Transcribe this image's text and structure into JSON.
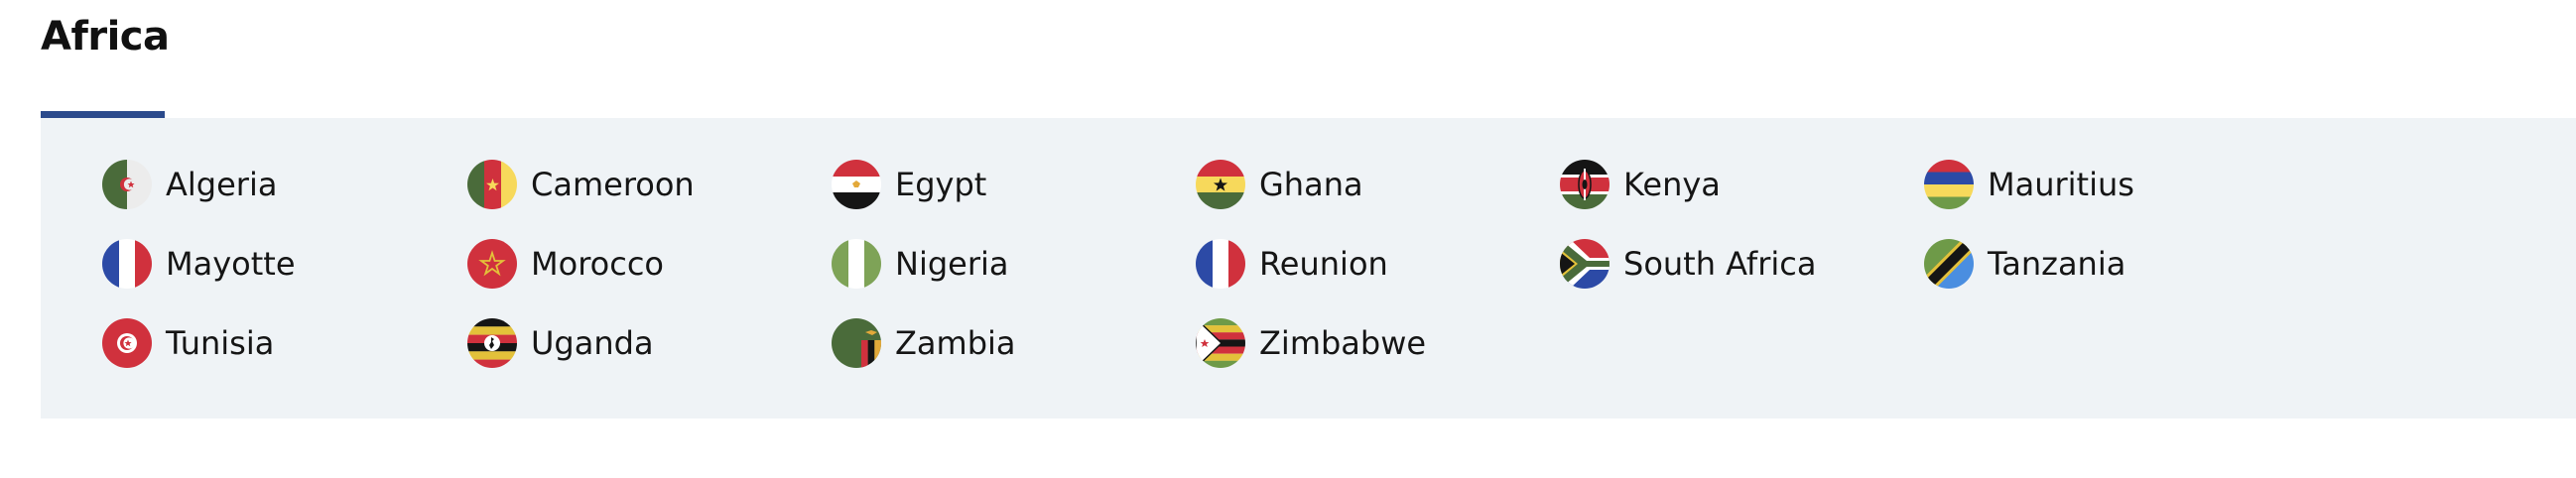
{
  "region": {
    "title": "Africa"
  },
  "countries": [
    {
      "name": "Algeria",
      "flag": "algeria-flag-icon"
    },
    {
      "name": "Cameroon",
      "flag": "cameroon-flag-icon"
    },
    {
      "name": "Egypt",
      "flag": "egypt-flag-icon"
    },
    {
      "name": "Ghana",
      "flag": "ghana-flag-icon"
    },
    {
      "name": "Kenya",
      "flag": "kenya-flag-icon"
    },
    {
      "name": "Mauritius",
      "flag": "mauritius-flag-icon"
    },
    {
      "name": "Mayotte",
      "flag": "mayotte-flag-icon"
    },
    {
      "name": "Morocco",
      "flag": "morocco-flag-icon"
    },
    {
      "name": "Nigeria",
      "flag": "nigeria-flag-icon"
    },
    {
      "name": "Reunion",
      "flag": "reunion-flag-icon"
    },
    {
      "name": "South Africa",
      "flag": "south-africa-flag-icon"
    },
    {
      "name": "Tanzania",
      "flag": "tanzania-flag-icon"
    },
    {
      "name": "Tunisia",
      "flag": "tunisia-flag-icon"
    },
    {
      "name": "Uganda",
      "flag": "uganda-flag-icon"
    },
    {
      "name": "Zambia",
      "flag": "zambia-flag-icon"
    },
    {
      "name": "Zimbabwe",
      "flag": "zimbabwe-flag-icon"
    }
  ],
  "colors": {
    "accent": "#2b4a8c",
    "panel_background": "#eff3f6"
  }
}
